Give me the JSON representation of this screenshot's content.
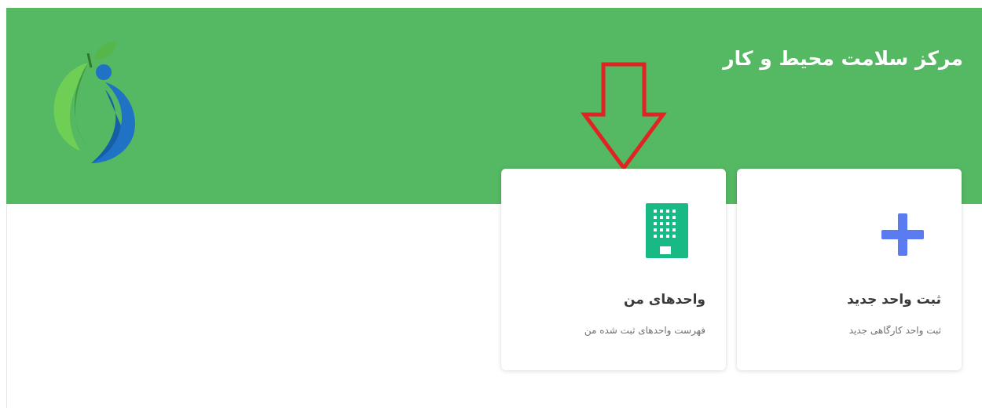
{
  "header": {
    "title": "مرکز سلامت محیط و کار",
    "logo_icon": "apple-leaf-logo-icon",
    "background_color": "#55b863"
  },
  "cards": [
    {
      "icon": "plus-icon",
      "icon_color": "#5b7cf0",
      "title": "ثبت واحد جدید",
      "subtitle": "ثبت واحد کارگاهی جدید"
    },
    {
      "icon": "building-icon",
      "icon_color": "#19b985",
      "title": "واحدهای من",
      "subtitle": "فهرست واحدهای ثبت شده من"
    }
  ],
  "annotation": {
    "icon": "red-down-arrow-icon",
    "color": "#e02424"
  }
}
